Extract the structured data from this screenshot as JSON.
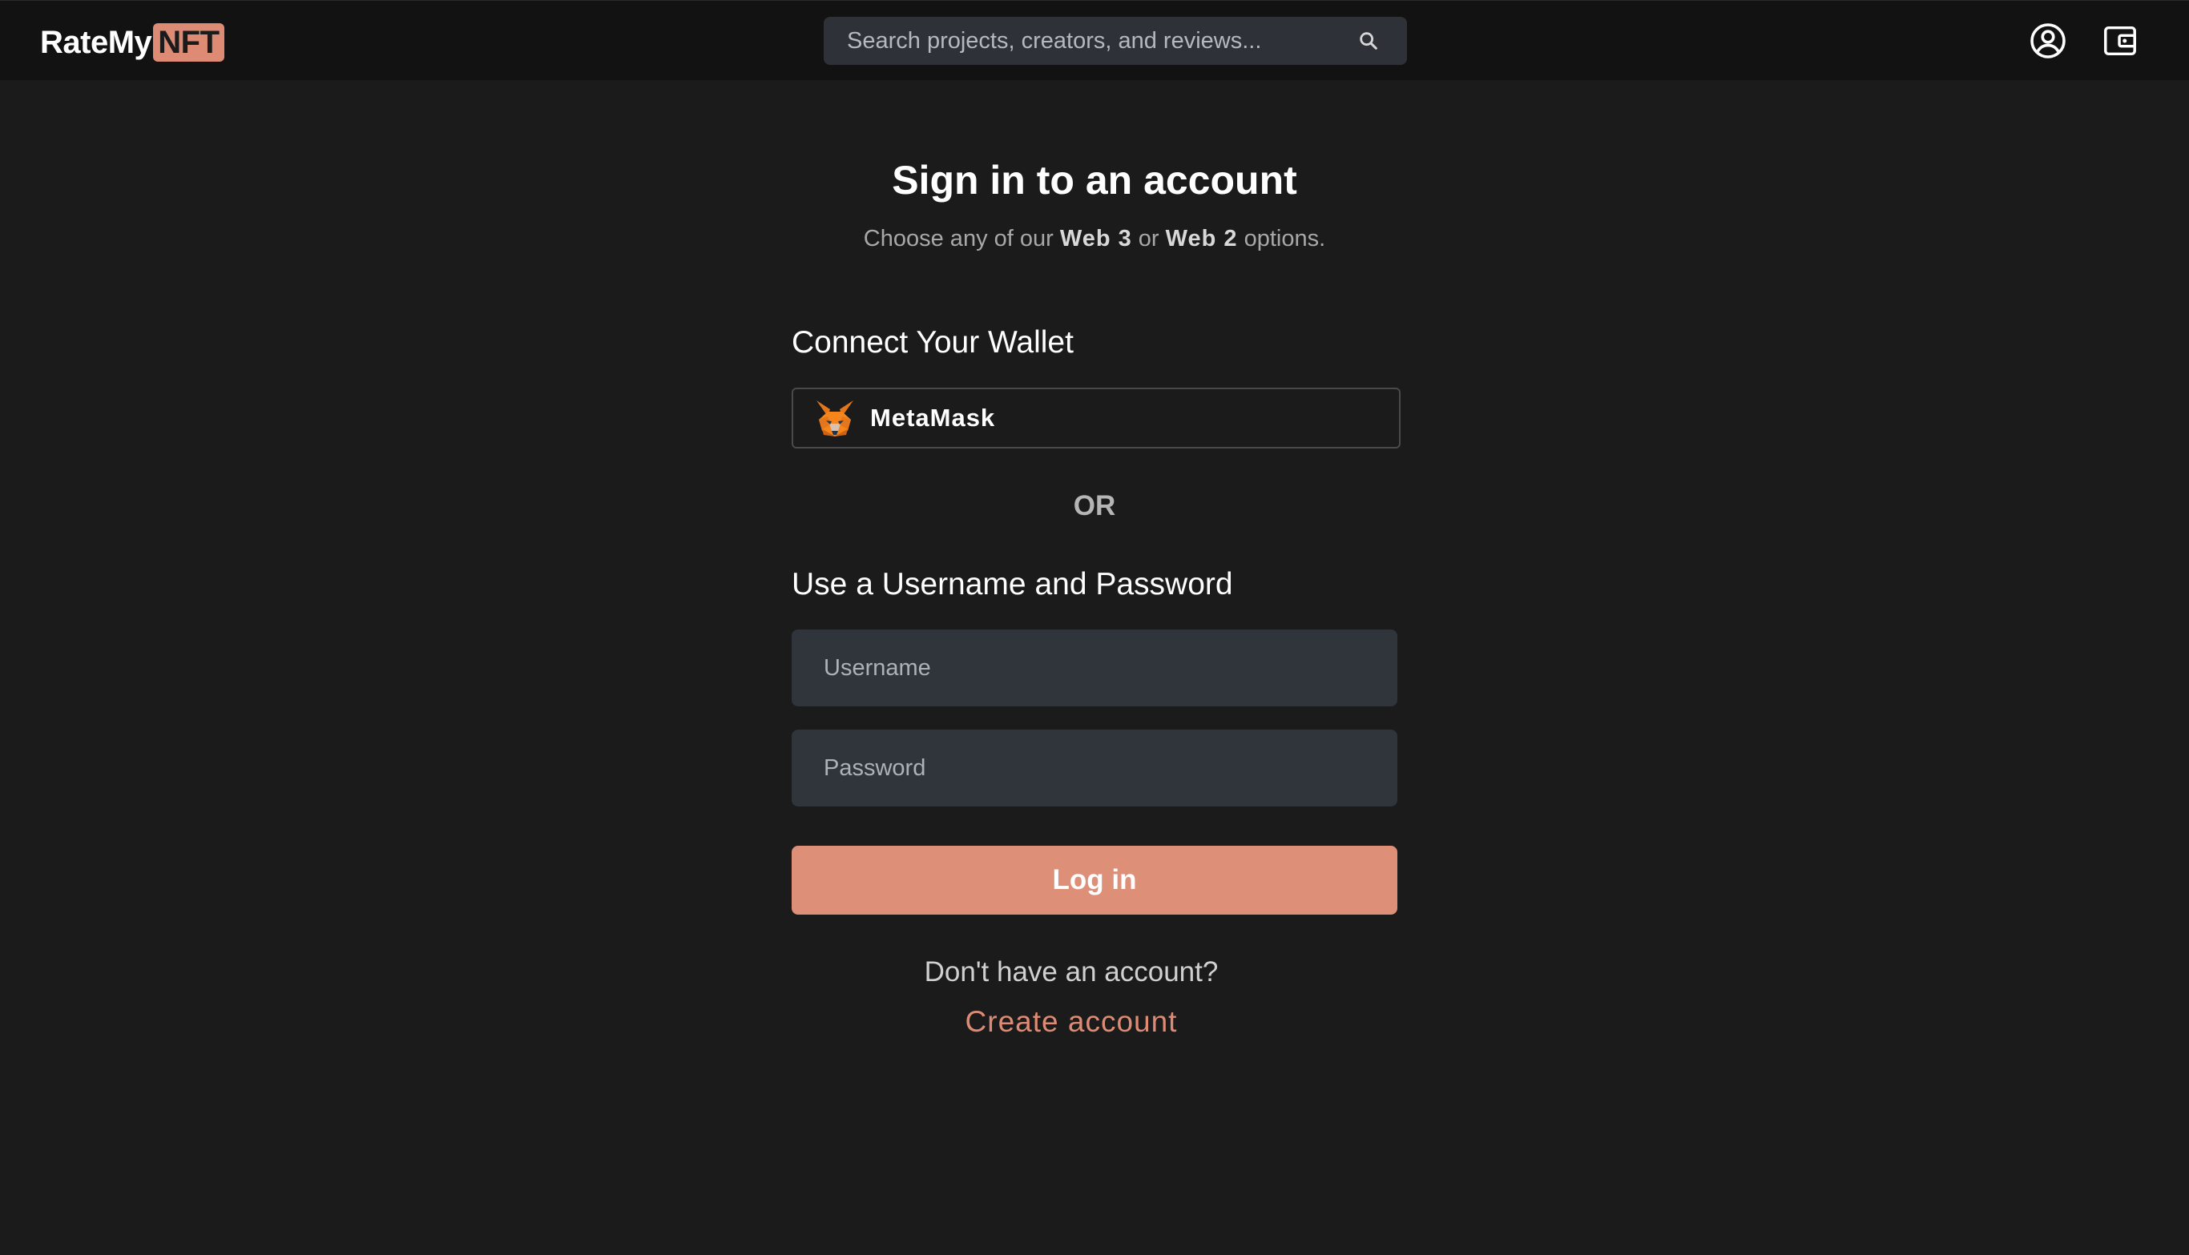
{
  "header": {
    "logo_main": "RateMy",
    "logo_badge": "NFT",
    "search_placeholder": "Search projects, creators, and reviews...",
    "icons": {
      "search": "search-icon",
      "account": "user-circle-icon",
      "wallet": "wallet-icon"
    }
  },
  "main": {
    "title": "Sign in to an account",
    "subtitle": {
      "prefix": "Choose any of our",
      "option1": "Web 3",
      "joiner": "or",
      "option2": "Web 2",
      "suffix": "options."
    },
    "wallet_section": {
      "label": "Connect Your Wallet",
      "provider_label": "MetaMask",
      "provider_icon": "metamask-fox-icon"
    },
    "divider": "OR",
    "credentials_section": {
      "label": "Use a Username and Password",
      "username_placeholder": "Username",
      "username_value": "",
      "password_placeholder": "Password",
      "password_value": ""
    },
    "login_label": "Log in",
    "no_account_text": "Don't have an account?",
    "create_account_label": "Create account"
  },
  "colors": {
    "background": "#1b1b1b",
    "header": "#121212",
    "accent": "#dd8f77",
    "input_bg": "#30343b"
  }
}
